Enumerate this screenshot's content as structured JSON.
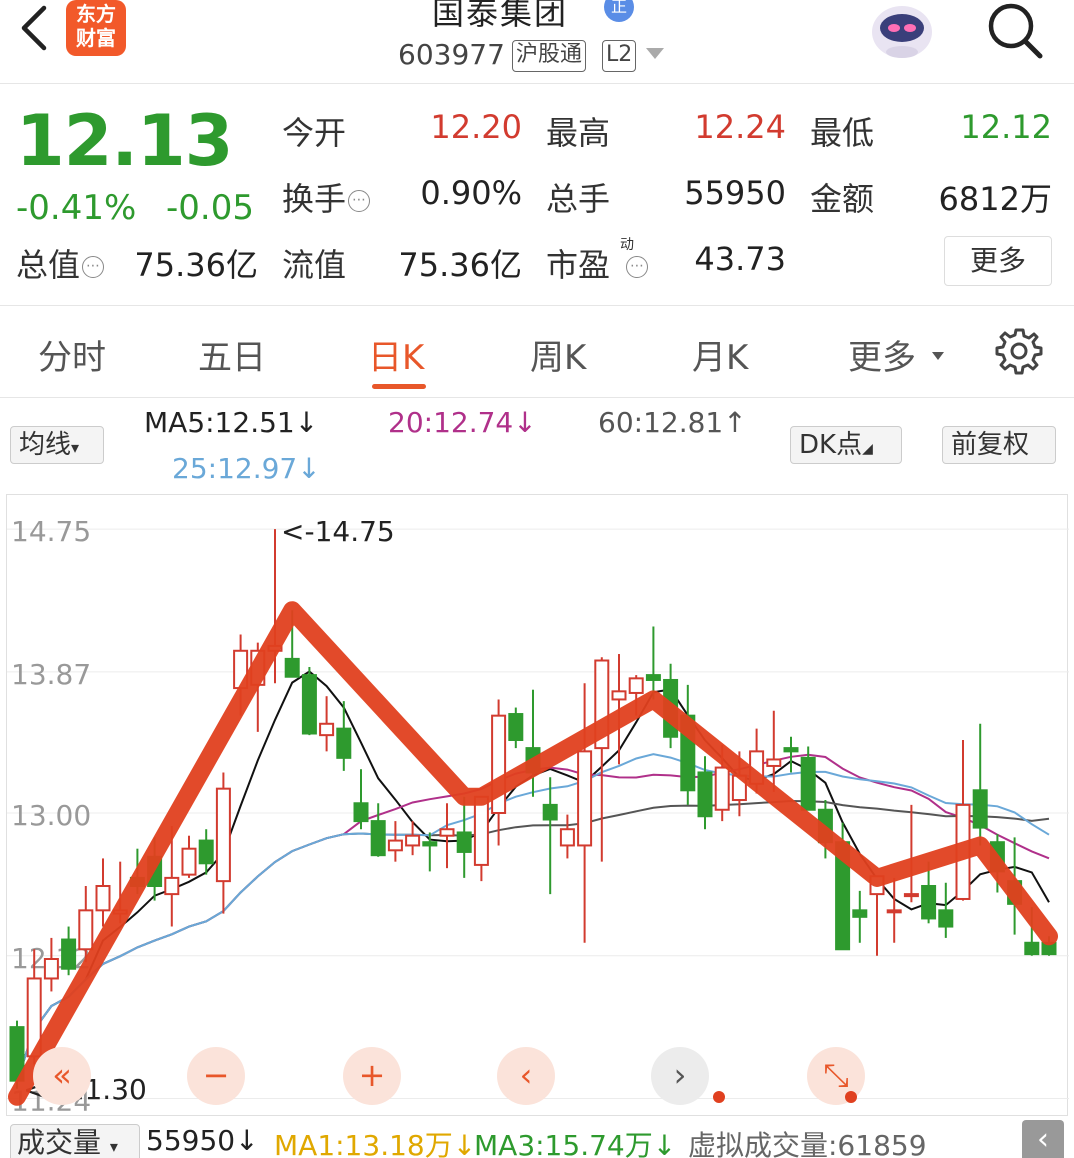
{
  "header": {
    "logo_line1": "东方",
    "logo_line2": "财富",
    "stock_name": "国泰集团",
    "name_badge": "正",
    "stock_code": "603977",
    "tag_hgt": "沪股通",
    "tag_l2": "L2"
  },
  "quote": {
    "price": "12.13",
    "change_pct": "-0.41%",
    "change_abs": "-0.05",
    "open_label": "今开",
    "open_value": "12.20",
    "high_label": "最高",
    "high_value": "12.24",
    "low_label": "最低",
    "low_value": "12.12",
    "turnover_label": "换手",
    "turnover_value": "0.90%",
    "volume_label": "总手",
    "volume_value": "55950",
    "amount_label": "金额",
    "amount_value": "6812万",
    "mktcap_label": "总值",
    "mktcap_value": "75.36亿",
    "float_label": "流值",
    "float_value": "75.36亿",
    "pe_label": "市盈",
    "pe_sup": "动",
    "pe_value": "43.73",
    "more_label": "更多"
  },
  "tabs": [
    "分时",
    "五日",
    "日K",
    "周K",
    "月K",
    "更多"
  ],
  "active_tab": "日K",
  "ma_legend": {
    "selector_label": "均线",
    "ma5": "MA5:12.51↓",
    "ma20": "20:12.74↓",
    "ma60": "60:12.81↑",
    "ma25": "25:12.97↓",
    "dk_label": "DK点",
    "fq_label": "前复权"
  },
  "chart_data": {
    "type": "candlestick",
    "y_ticks": [
      "14.75",
      "13.87",
      "13.00",
      "12.12",
      "11.24"
    ],
    "ylim": [
      11.2,
      14.8
    ],
    "max_annotation": "<-14.75",
    "min_annotation": "<--11.30",
    "candles": [
      {
        "o": 11.68,
        "h": 11.72,
        "l": 11.3,
        "c": 11.35
      },
      {
        "o": 11.5,
        "h": 12.16,
        "l": 11.45,
        "c": 11.98
      },
      {
        "o": 11.98,
        "h": 12.23,
        "l": 11.9,
        "c": 12.1
      },
      {
        "o": 12.22,
        "h": 12.3,
        "l": 12.0,
        "c": 12.04
      },
      {
        "o": 12.16,
        "h": 12.55,
        "l": 12.08,
        "c": 12.4
      },
      {
        "o": 12.4,
        "h": 12.72,
        "l": 12.3,
        "c": 12.55
      },
      {
        "o": 12.38,
        "h": 12.7,
        "l": 12.32,
        "c": 12.4
      },
      {
        "o": 12.6,
        "h": 12.78,
        "l": 12.5,
        "c": 12.55
      },
      {
        "o": 12.73,
        "h": 12.85,
        "l": 12.46,
        "c": 12.55
      },
      {
        "o": 12.5,
        "h": 12.92,
        "l": 12.3,
        "c": 12.6
      },
      {
        "o": 12.62,
        "h": 12.86,
        "l": 12.6,
        "c": 12.78
      },
      {
        "o": 12.83,
        "h": 12.9,
        "l": 12.62,
        "c": 12.69
      },
      {
        "o": 12.58,
        "h": 13.25,
        "l": 12.38,
        "c": 13.15
      },
      {
        "o": 13.77,
        "h": 14.1,
        "l": 13.6,
        "c": 14.0
      },
      {
        "o": 13.79,
        "h": 14.05,
        "l": 13.5,
        "c": 14.0
      },
      {
        "o": 14.0,
        "h": 14.75,
        "l": 13.8,
        "c": 14.03
      },
      {
        "o": 13.95,
        "h": 14.25,
        "l": 13.9,
        "c": 13.84
      },
      {
        "o": 13.85,
        "h": 13.9,
        "l": 13.48,
        "c": 13.49
      },
      {
        "o": 13.48,
        "h": 13.72,
        "l": 13.38,
        "c": 13.55
      },
      {
        "o": 13.52,
        "h": 13.69,
        "l": 13.26,
        "c": 13.34
      },
      {
        "o": 13.06,
        "h": 13.27,
        "l": 12.9,
        "c": 12.95
      },
      {
        "o": 12.95,
        "h": 13.06,
        "l": 12.73,
        "c": 12.74
      },
      {
        "o": 12.77,
        "h": 12.95,
        "l": 12.7,
        "c": 12.83
      },
      {
        "o": 12.8,
        "h": 12.95,
        "l": 12.74,
        "c": 12.86
      },
      {
        "o": 12.82,
        "h": 12.88,
        "l": 12.64,
        "c": 12.8
      },
      {
        "o": 12.86,
        "h": 13.06,
        "l": 12.66,
        "c": 12.9
      },
      {
        "o": 12.88,
        "h": 13.1,
        "l": 12.6,
        "c": 12.76
      },
      {
        "o": 12.68,
        "h": 13.1,
        "l": 12.58,
        "c": 13.1
      },
      {
        "o": 13.0,
        "h": 13.7,
        "l": 12.8,
        "c": 13.6
      },
      {
        "o": 13.61,
        "h": 13.65,
        "l": 13.4,
        "c": 13.45
      },
      {
        "o": 13.4,
        "h": 13.76,
        "l": 13.1,
        "c": 13.25
      },
      {
        "o": 13.05,
        "h": 13.22,
        "l": 12.5,
        "c": 12.96
      },
      {
        "o": 12.8,
        "h": 12.99,
        "l": 12.72,
        "c": 12.9
      },
      {
        "o": 12.8,
        "h": 13.8,
        "l": 12.2,
        "c": 13.38
      },
      {
        "o": 13.4,
        "h": 13.96,
        "l": 12.7,
        "c": 13.94
      },
      {
        "o": 13.7,
        "h": 13.98,
        "l": 13.3,
        "c": 13.75
      },
      {
        "o": 13.74,
        "h": 13.85,
        "l": 13.6,
        "c": 13.83
      },
      {
        "o": 13.85,
        "h": 14.15,
        "l": 13.7,
        "c": 13.82
      },
      {
        "o": 13.82,
        "h": 13.92,
        "l": 13.4,
        "c": 13.47
      },
      {
        "o": 13.6,
        "h": 13.79,
        "l": 13.05,
        "c": 13.14
      },
      {
        "o": 13.25,
        "h": 13.35,
        "l": 12.9,
        "c": 12.98
      },
      {
        "o": 13.02,
        "h": 13.42,
        "l": 12.95,
        "c": 13.28
      },
      {
        "o": 13.08,
        "h": 13.38,
        "l": 12.98,
        "c": 13.23
      },
      {
        "o": 13.18,
        "h": 13.52,
        "l": 13.12,
        "c": 13.38
      },
      {
        "o": 13.29,
        "h": 13.63,
        "l": 13.13,
        "c": 13.33
      },
      {
        "o": 13.4,
        "h": 13.47,
        "l": 13.25,
        "c": 13.38
      },
      {
        "o": 13.34,
        "h": 13.41,
        "l": 13.02,
        "c": 13.02
      },
      {
        "o": 13.02,
        "h": 13.08,
        "l": 12.72,
        "c": 12.82
      },
      {
        "o": 12.82,
        "h": 12.94,
        "l": 12.16,
        "c": 12.16
      },
      {
        "o": 12.4,
        "h": 12.52,
        "l": 12.2,
        "c": 12.36
      },
      {
        "o": 12.5,
        "h": 12.6,
        "l": 12.12,
        "c": 12.61
      },
      {
        "o": 12.4,
        "h": 12.6,
        "l": 12.2,
        "c": 12.4
      },
      {
        "o": 12.5,
        "h": 13.05,
        "l": 12.45,
        "c": 12.5
      },
      {
        "o": 12.55,
        "h": 12.7,
        "l": 12.32,
        "c": 12.35
      },
      {
        "o": 12.4,
        "h": 12.57,
        "l": 12.23,
        "c": 12.3
      },
      {
        "o": 12.47,
        "h": 13.45,
        "l": 12.46,
        "c": 13.05
      },
      {
        "o": 13.14,
        "h": 13.55,
        "l": 12.8,
        "c": 12.91
      },
      {
        "o": 12.82,
        "h": 12.87,
        "l": 12.51,
        "c": 12.64
      },
      {
        "o": 12.58,
        "h": 12.85,
        "l": 12.25,
        "c": 12.44
      },
      {
        "o": 12.2,
        "h": 12.42,
        "l": 12.12,
        "c": 12.13
      },
      {
        "o": 12.2,
        "h": 12.24,
        "l": 12.12,
        "c": 12.13
      }
    ],
    "ma_series": [
      {
        "key": "ma5",
        "color": "#111111"
      },
      {
        "key": "ma20",
        "color": "#b0308a"
      },
      {
        "key": "ma60",
        "color": "#555555"
      },
      {
        "key": "ma25",
        "color": "#6aa8d8"
      }
    ]
  },
  "controls": {
    "rewind": "«",
    "zoom_out": "−",
    "zoom_in": "+",
    "prev": "‹",
    "next": "›",
    "expand": "⤡"
  },
  "bottom": {
    "indicator_label": "成交量",
    "volume": "55950↓",
    "ma1": "MA1:13.18万↓",
    "ma3": "MA3:15.74万↓",
    "virtual": "虚拟成交量:61859",
    "collapse": "‹"
  },
  "colors": {
    "up": "#d23b2f",
    "down": "#2e9a2e",
    "accent": "#e8572a",
    "overlay": "#e0401f"
  }
}
